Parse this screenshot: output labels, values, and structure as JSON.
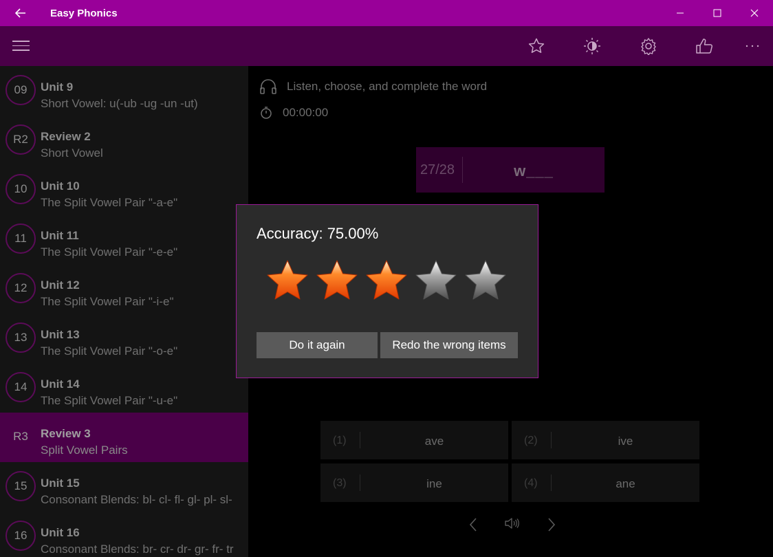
{
  "app": {
    "title": "Easy Phonics"
  },
  "toolbar": {
    "icons": [
      "star-icon",
      "brightness-icon",
      "settings-icon",
      "thumbs-up-icon",
      "more-icon"
    ]
  },
  "sidebar": {
    "units": [
      {
        "badge": "09",
        "title": "Unit 9",
        "subtitle": "Short Vowel: u(-ub -ug -un -ut)"
      },
      {
        "badge": "R2",
        "title": "Review 2",
        "subtitle": "Short Vowel"
      },
      {
        "badge": "10",
        "title": "Unit 10",
        "subtitle": "The Split Vowel Pair \"-a-e\""
      },
      {
        "badge": "11",
        "title": "Unit 11",
        "subtitle": "The Split Vowel Pair \"-e-e\""
      },
      {
        "badge": "12",
        "title": "Unit 12",
        "subtitle": "The Split Vowel Pair \"-i-e\""
      },
      {
        "badge": "13",
        "title": "Unit 13",
        "subtitle": "The Split Vowel Pair \"-o-e\""
      },
      {
        "badge": "14",
        "title": "Unit 14",
        "subtitle": "The Split Vowel Pair \"-u-e\""
      },
      {
        "badge": "R3",
        "title": "Review 3",
        "subtitle": "Split Vowel Pairs",
        "selected": true
      },
      {
        "badge": "15",
        "title": "Unit 15",
        "subtitle": "Consonant Blends: bl- cl- fl- gl- pl- sl-"
      },
      {
        "badge": "16",
        "title": "Unit 16",
        "subtitle": "Consonant Blends: br- cr- dr- gr- fr- tr"
      }
    ]
  },
  "main": {
    "instruction": "Listen, choose, and complete the word",
    "timer": "00:00:00",
    "progress": "27/28",
    "word": "w___",
    "options": [
      {
        "num": "(1)",
        "text": "ave"
      },
      {
        "num": "(2)",
        "text": "ive"
      },
      {
        "num": "(3)",
        "text": "ine"
      },
      {
        "num": "(4)",
        "text": "ane"
      }
    ]
  },
  "dialog": {
    "accuracy": "Accuracy: 75.00%",
    "stars_filled": 3,
    "stars_total": 5,
    "again_label": "Do it again",
    "redo_label": "Redo the wrong items"
  },
  "colors": {
    "titlebar": "#990099",
    "toolbar": "#4a0048",
    "accent_border": "#9b1a98",
    "star_filled": "#ff5a0a",
    "star_empty": "#8c8c8c"
  }
}
